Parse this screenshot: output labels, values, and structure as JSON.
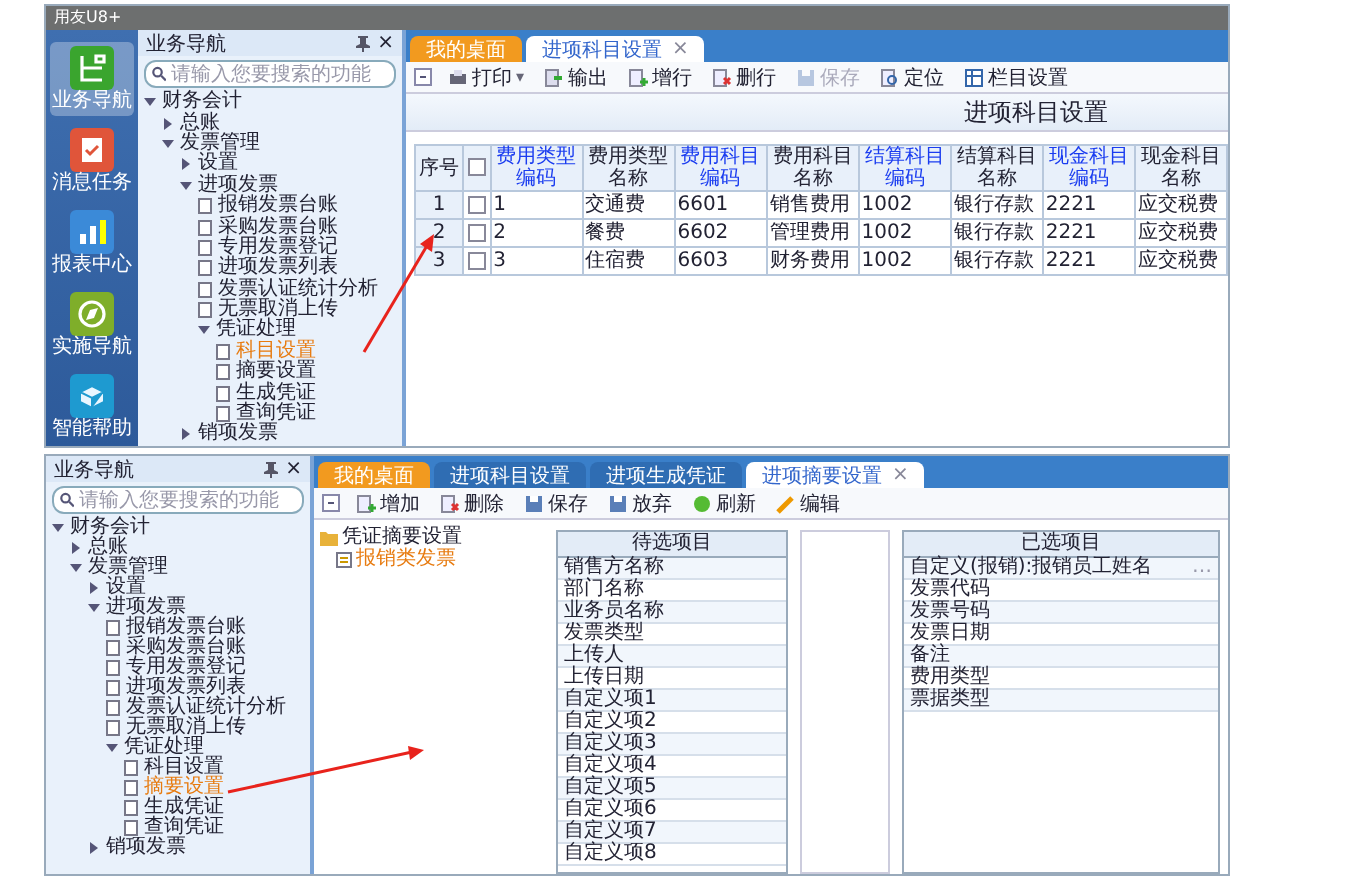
{
  "screens": [
    {
      "title_bar": "用友U8+",
      "nav_rail": [
        {
          "label": "业务导航",
          "selected": true
        },
        {
          "label": "消息任务",
          "selected": false
        },
        {
          "label": "报表中心",
          "selected": false
        },
        {
          "label": "实施导航",
          "selected": false
        },
        {
          "label": "智能帮助",
          "selected": false
        }
      ],
      "sidebar": {
        "title": "业务导航",
        "close": "×",
        "placeholder": "请输入您要搜索的功能",
        "tree": [
          {
            "label": "财务会计",
            "selected": false,
            "expanded": true,
            "children": [
              {
                "label": "总账",
                "selected": false,
                "expanded": false
              },
              {
                "label": "发票管理",
                "selected": false,
                "expanded": true,
                "children": [
                  {
                    "label": "设置",
                    "selected": false,
                    "expanded": false
                  },
                  {
                    "label": "进项发票",
                    "selected": false,
                    "expanded": true,
                    "children": [
                      {
                        "label": "报销发票台账",
                        "selected": false
                      },
                      {
                        "label": "采购发票台账",
                        "selected": false
                      },
                      {
                        "label": "专用发票登记",
                        "selected": false
                      },
                      {
                        "label": "进项发票列表",
                        "selected": false
                      },
                      {
                        "label": "发票认证统计分析",
                        "selected": false
                      },
                      {
                        "label": "无票取消上传",
                        "selected": false
                      },
                      {
                        "label": "凭证处理",
                        "selected": false,
                        "expanded": true,
                        "children": [
                          {
                            "label": "科目设置",
                            "selected": true
                          },
                          {
                            "label": "摘要设置",
                            "selected": false
                          },
                          {
                            "label": "生成凭证",
                            "selected": false
                          },
                          {
                            "label": "查询凭证",
                            "selected": false
                          }
                        ]
                      }
                    ]
                  },
                  {
                    "label": "销项发票",
                    "selected": false,
                    "expanded": false
                  }
                ]
              }
            ]
          }
        ]
      },
      "tabs": [
        {
          "label": "我的桌面",
          "selected": false
        },
        {
          "label": "进项科目设置",
          "selected": true,
          "close": "×"
        }
      ],
      "toolbar": [
        {
          "label": "打印",
          "disabled": false,
          "caret": "▾"
        },
        {
          "label": "输出",
          "disabled": false
        },
        {
          "label": "增行",
          "disabled": false
        },
        {
          "label": "删行",
          "disabled": false
        },
        {
          "label": "保存",
          "disabled": true
        },
        {
          "label": "定位",
          "disabled": false
        },
        {
          "label": "栏目设置",
          "disabled": false
        }
      ],
      "page_title": "进项科目设置",
      "table": {
        "all_checked": false,
        "columns": [
          {
            "label": "序号",
            "kind": "index"
          },
          {
            "kind": "check"
          },
          {
            "label": "费用类型编码",
            "kind": "code"
          },
          {
            "label": "费用类型名称",
            "kind": "name"
          },
          {
            "label": "费用科目编码",
            "kind": "code"
          },
          {
            "label": "费用科目名称",
            "kind": "name"
          },
          {
            "label": "结算科目编码",
            "kind": "code"
          },
          {
            "label": "结算科目名称",
            "kind": "name"
          },
          {
            "label": "现金科目编码",
            "kind": "code"
          },
          {
            "label": "现金科目名称",
            "kind": "name"
          }
        ],
        "rows": [
          {
            "checked": false,
            "cells": [
              "1",
              "",
              "1",
              "交通费",
              "6601",
              "销售费用",
              "1002",
              "银行存款",
              "2221",
              "应交税费"
            ]
          },
          {
            "checked": false,
            "cells": [
              "2",
              "",
              "2",
              "餐费",
              "6602",
              "管理费用",
              "1002",
              "银行存款",
              "2221",
              "应交税费"
            ]
          },
          {
            "checked": false,
            "cells": [
              "3",
              "",
              "3",
              "住宿费",
              "6603",
              "财务费用",
              "1002",
              "银行存款",
              "2221",
              "应交税费"
            ]
          }
        ]
      }
    },
    {
      "sidebar": {
        "title": "业务导航",
        "close": "×",
        "placeholder": "请输入您要搜索的功能",
        "tree": [
          {
            "label": "财务会计",
            "selected": false,
            "expanded": true,
            "children": [
              {
                "label": "总账",
                "selected": false,
                "expanded": false
              },
              {
                "label": "发票管理",
                "selected": false,
                "expanded": true,
                "children": [
                  {
                    "label": "设置",
                    "selected": false,
                    "expanded": false
                  },
                  {
                    "label": "进项发票",
                    "selected": false,
                    "expanded": true,
                    "children": [
                      {
                        "label": "报销发票台账",
                        "selected": false
                      },
                      {
                        "label": "采购发票台账",
                        "selected": false
                      },
                      {
                        "label": "专用发票登记",
                        "selected": false
                      },
                      {
                        "label": "进项发票列表",
                        "selected": false
                      },
                      {
                        "label": "发票认证统计分析",
                        "selected": false
                      },
                      {
                        "label": "无票取消上传",
                        "selected": false
                      },
                      {
                        "label": "凭证处理",
                        "selected": false,
                        "expanded": true,
                        "children": [
                          {
                            "label": "科目设置",
                            "selected": false
                          },
                          {
                            "label": "摘要设置",
                            "selected": true
                          },
                          {
                            "label": "生成凭证",
                            "selected": false
                          },
                          {
                            "label": "查询凭证",
                            "selected": false
                          }
                        ]
                      }
                    ]
                  },
                  {
                    "label": "销项发票",
                    "selected": false,
                    "expanded": false
                  }
                ]
              }
            ]
          }
        ]
      },
      "tabs": [
        {
          "label": "我的桌面",
          "selected": false
        },
        {
          "label": "进项科目设置",
          "selected": false
        },
        {
          "label": "进项生成凭证",
          "selected": false
        },
        {
          "label": "进项摘要设置",
          "selected": true,
          "close": "×"
        }
      ],
      "toolbar": [
        {
          "label": "增加",
          "disabled": false
        },
        {
          "label": "删除",
          "disabled": false
        },
        {
          "label": "保存",
          "disabled": false
        },
        {
          "label": "放弃",
          "disabled": false
        },
        {
          "label": "刷新",
          "disabled": false
        },
        {
          "label": "编辑",
          "disabled": false
        }
      ],
      "content_tree": [
        {
          "label": "凭证摘要设置",
          "selected": false,
          "expanded": true,
          "children": [
            {
              "label": "报销类发票",
              "selected": true
            }
          ]
        }
      ],
      "available": {
        "title": "待选项目",
        "items": [
          "销售方名称",
          "部门名称",
          "业务员名称",
          "发票类型",
          "上传人",
          "上传日期",
          "自定义项1",
          "自定义项2",
          "自定义项3",
          "自定义项4",
          "自定义项5",
          "自定义项6",
          "自定义项7",
          "自定义项8"
        ]
      },
      "chosen": {
        "title": "已选项目",
        "items": [
          {
            "label": "自定义(报销):报销员工姓名",
            "more": "…"
          },
          {
            "label": "发票代码"
          },
          {
            "label": "发票号码"
          },
          {
            "label": "发票日期"
          },
          {
            "label": "备注"
          },
          {
            "label": "费用类型"
          },
          {
            "label": "票据类型"
          }
        ]
      }
    }
  ]
}
